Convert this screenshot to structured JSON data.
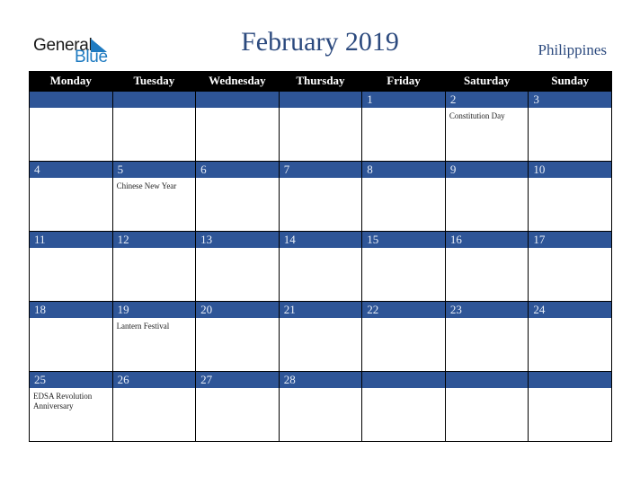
{
  "logo": {
    "line1": "General",
    "line2": "Blue"
  },
  "title": "February 2019",
  "country": "Philippines",
  "colors": {
    "header_bg": "#000000",
    "date_bar": "#2e5597",
    "title": "#2c4a7e",
    "logo_blue": "#1f7bc1"
  },
  "weekdays": [
    "Monday",
    "Tuesday",
    "Wednesday",
    "Thursday",
    "Friday",
    "Saturday",
    "Sunday"
  ],
  "weeks": [
    [
      {
        "day": "",
        "event": ""
      },
      {
        "day": "",
        "event": ""
      },
      {
        "day": "",
        "event": ""
      },
      {
        "day": "",
        "event": ""
      },
      {
        "day": "1",
        "event": ""
      },
      {
        "day": "2",
        "event": "Constitution Day"
      },
      {
        "day": "3",
        "event": ""
      }
    ],
    [
      {
        "day": "4",
        "event": ""
      },
      {
        "day": "5",
        "event": "Chinese New Year"
      },
      {
        "day": "6",
        "event": ""
      },
      {
        "day": "7",
        "event": ""
      },
      {
        "day": "8",
        "event": ""
      },
      {
        "day": "9",
        "event": ""
      },
      {
        "day": "10",
        "event": ""
      }
    ],
    [
      {
        "day": "11",
        "event": ""
      },
      {
        "day": "12",
        "event": ""
      },
      {
        "day": "13",
        "event": ""
      },
      {
        "day": "14",
        "event": ""
      },
      {
        "day": "15",
        "event": ""
      },
      {
        "day": "16",
        "event": ""
      },
      {
        "day": "17",
        "event": ""
      }
    ],
    [
      {
        "day": "18",
        "event": ""
      },
      {
        "day": "19",
        "event": "Lantern Festival"
      },
      {
        "day": "20",
        "event": ""
      },
      {
        "day": "21",
        "event": ""
      },
      {
        "day": "22",
        "event": ""
      },
      {
        "day": "23",
        "event": ""
      },
      {
        "day": "24",
        "event": ""
      }
    ],
    [
      {
        "day": "25",
        "event": "EDSA Revolution Anniversary"
      },
      {
        "day": "26",
        "event": ""
      },
      {
        "day": "27",
        "event": ""
      },
      {
        "day": "28",
        "event": ""
      },
      {
        "day": "",
        "event": ""
      },
      {
        "day": "",
        "event": ""
      },
      {
        "day": "",
        "event": ""
      }
    ]
  ]
}
